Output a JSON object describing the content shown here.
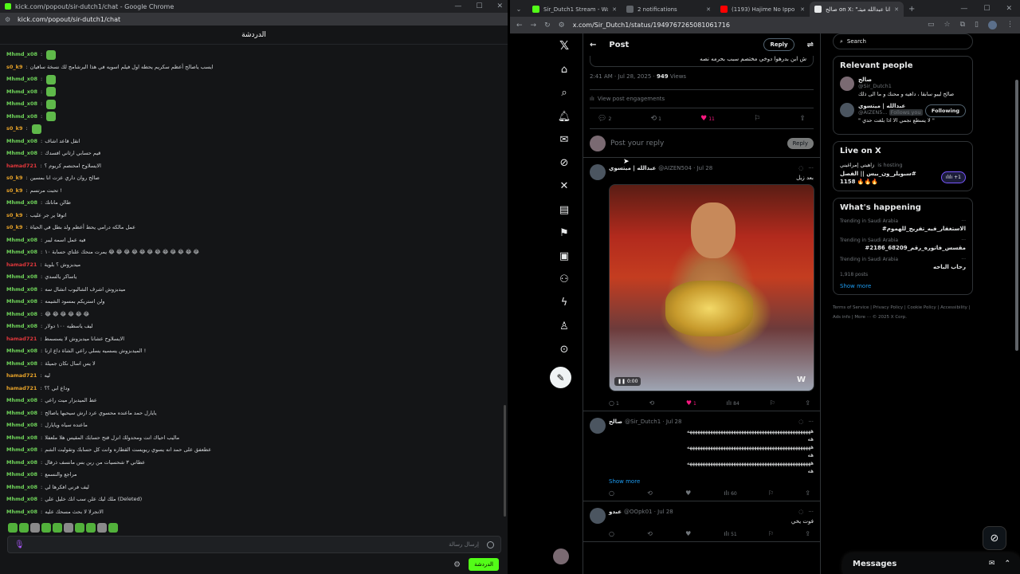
{
  "kick": {
    "window_title": "kick.com/popout/sir-dutch1/chat - Google Chrome",
    "url": "kick.com/popout/sir-dutch1/chat",
    "header": "الدردشة",
    "messages": [
      {
        "user": "Mhmd_x08",
        "text": "",
        "color": "#6fd35a",
        "emote": true
      },
      {
        "user": "s0_k9",
        "text": "ايسب ياصالح أعظم سكريم يحطه اول فيلم اسويه في هذا البرشامج لك نسخة سافيان",
        "color": "#e6a229",
        "emote": false
      },
      {
        "user": "Mhmd_x08",
        "text": "",
        "color": "#6fd35a",
        "emote": true
      },
      {
        "user": "Mhmd_x08",
        "text": "",
        "color": "#6fd35a",
        "emote": true
      },
      {
        "user": "Mhmd_x08",
        "text": "",
        "color": "#6fd35a",
        "emote": true
      },
      {
        "user": "Mhmd_x08",
        "text": "",
        "color": "#6fd35a",
        "emote": true
      },
      {
        "user": "s0_k9",
        "text": "",
        "color": "#e6a229",
        "emote": true
      },
      {
        "user": "Mhmd_x08",
        "text": "انقل قاعد اشاف",
        "color": "#6fd35a",
        "emote": false
      },
      {
        "user": "Mhmd_x08",
        "text": "قيم حسابي ارثاني افسدك",
        "color": "#6fd35a",
        "emote": false
      },
      {
        "user": "hamad721",
        "text": "الايسلاوح امحنصم كريوم ؟",
        "color": "#e0373b",
        "emote": false
      },
      {
        "user": "s0_k9",
        "text": "صالح روان داري عزت انا بمسين",
        "color": "#e6a229",
        "emote": false
      },
      {
        "user": "s0_k9",
        "text": "تحبت مرتسم !",
        "color": "#e6a229",
        "emote": false
      },
      {
        "user": "Mhmd_x08",
        "text": "طالن ماناتك",
        "color": "#6fd35a",
        "emote": false
      },
      {
        "user": "s0_k9",
        "text": "اتوقا ير جر عليب",
        "color": "#e6a229",
        "emote": false
      },
      {
        "user": "s0_k9",
        "text": "عمل مالكه درامي يحط أعظم ولد بطل في الحياة",
        "color": "#e6a229",
        "emote": false
      },
      {
        "user": "Mhmd_x08",
        "text": "فيه عمل اسمه ليبر",
        "color": "#6fd35a",
        "emote": false
      },
      {
        "user": "Mhmd_x08",
        "text": "يمرت منحك علناي حسابة ١٠ 😂 😂 😂 😂 😂 😂 😂 😂 😂 😂 😂 😂",
        "color": "#6fd35a",
        "emote": false
      },
      {
        "user": "hamad721",
        "text": "ميدبزوش ؟ بلوية",
        "color": "#e0373b",
        "emote": false
      },
      {
        "user": "Mhmd_x08",
        "text": "ياساكر يالسدي",
        "color": "#6fd35a",
        "emote": false
      },
      {
        "user": "Mhmd_x08",
        "text": "ميدبزوش اشرف الشاليوب انشال سه",
        "color": "#6fd35a",
        "emote": false
      },
      {
        "user": "Mhmd_x08",
        "text": "ولن استريكم بمسود الشيمه",
        "color": "#6fd35a",
        "emote": false
      },
      {
        "user": "Mhmd_x08",
        "text": "😂 😂 😂 😂 😂 😂",
        "color": "#6fd35a",
        "emote": false
      },
      {
        "user": "Mhmd_x08",
        "text": "ليف ياسطيه ١٠٠ دولار",
        "color": "#6fd35a",
        "emote": false
      },
      {
        "user": "hamad721",
        "text": "الايسلاوح عشانا ميدبزوش لا يسسمط",
        "color": "#e0373b",
        "emote": false
      },
      {
        "user": "Mhmd_x08",
        "text": "الميدبزوش يسسيه يسلي راعي الشاة داع ازنا !",
        "color": "#6fd35a",
        "emote": false
      },
      {
        "user": "Mhmd_x08",
        "text": "لا يس اسال نكان جميلة",
        "color": "#6fd35a",
        "emote": false
      },
      {
        "user": "hamad721",
        "text": "ليه",
        "color": "#e6a229",
        "emote": false
      },
      {
        "user": "hamad721",
        "text": "وداع ابي ؟؟",
        "color": "#e6a229",
        "emote": false
      },
      {
        "user": "Mhmd_x08",
        "text": "عط الميدبزار ميت راعي",
        "color": "#6fd35a",
        "emote": false
      },
      {
        "user": "Mhmd_x08",
        "text": "يايارل حمد ماعنده محسوي عرد ارش سيحيها ياصالح",
        "color": "#6fd35a",
        "emote": false
      },
      {
        "user": "Mhmd_x08",
        "text": "ماعنده سياه ويايارل",
        "color": "#6fd35a",
        "emote": false
      },
      {
        "user": "Mhmd_x08",
        "text": "ماليب احياك انت ومحدولك انزل قتح حسابك المقيس هلا ملعفلا",
        "color": "#6fd35a",
        "emote": false
      },
      {
        "user": "Mhmd_x08",
        "text": "عطعفق على حمد انه يسوي ريويست القطاره وانت كل حسابك وتقوليت الشم",
        "color": "#6fd35a",
        "emote": false
      },
      {
        "user": "Mhmd_x08",
        "text": "عطاني ٣ شحسيات من ربن بس مانسف ذرفال",
        "color": "#6fd35a",
        "emote": false
      },
      {
        "user": "Mhmd_x08",
        "text": "مراجع والنسمع",
        "color": "#6fd35a",
        "emote": false
      },
      {
        "user": "Mhmd_x08",
        "text": "ليف فرني افكرها لي",
        "color": "#6fd35a",
        "emote": false
      },
      {
        "user": "Mhmd_x08",
        "text": "ملك ليك علن سب انك خليل علي (Deleted)",
        "color": "#6fd35a",
        "emote": false
      },
      {
        "user": "Mhmd_x08",
        "text": "الانجرلا لا بحث مسحك عليه",
        "color": "#6fd35a",
        "emote": false
      }
    ],
    "input_placeholder": "إرسال رسالة",
    "send_label": "الدردشة"
  },
  "chrome": {
    "tabs": [
      {
        "title": "Sir_Dutch1 Stream - Watch",
        "color": "#53fc18",
        "active": false
      },
      {
        "title": "2 notifications",
        "color": "#5f6368",
        "active": false
      },
      {
        "title": "(1193) Hajime No Ippo OP 2",
        "color": "#ff0000",
        "active": false
      },
      {
        "title": "صالح on X: \"ليتك انا عبدالله ميتـ",
        "color": "#e7e9ea",
        "active": true
      }
    ],
    "url": "x.com/Sir_Dutch1/status/1949767265081061716"
  },
  "x": {
    "post_header": "Post",
    "reply_button": "Reply",
    "quoted_tail": "ش ابن بدرهوا دوخي مختصم سبب بحرمه نصه",
    "timestamp": "2:41 AM · Jul 28, 2025 · ",
    "views_count": "949",
    "views_label": " Views",
    "view_engagements": "View post engagements",
    "counts": {
      "replies": "2",
      "reposts": "1",
      "likes": "11"
    },
    "reply_placeholder": "Post your reply",
    "reply_btn": "Reply",
    "tweets": [
      {
        "name": "عبدالله | ميتسوي",
        "handle": "@AIZEN504 · Jul 28",
        "text": "بعد زيل",
        "replies": "1",
        "reposts": "",
        "likes": "1",
        "views": "84",
        "media": true,
        "media_time": "0:00",
        "media_logo": "W"
      },
      {
        "name": "صالح",
        "handle": "@Sir_Dutch1 · Jul 28",
        "text": "ههههههههههههههههههههههههههههههههههههههههههههههههه\nهه\nههههههههههههههههههههههههههههههههههههههههههههههههه\nهه\nههههههههههههههههههههههههههههههههههههههههههههههههه\nهه",
        "show_more": "Show more",
        "replies": "",
        "reposts": "",
        "likes": "",
        "views": "60",
        "media": false
      },
      {
        "name": "عبدو",
        "handle": "@OOpk01 · Jul 28",
        "text": "فوت يخي",
        "replies": "",
        "reposts": "",
        "likes": "",
        "views": "51",
        "media": false
      }
    ],
    "search_placeholder": "Search",
    "relevant_title": "Relevant people",
    "people": [
      {
        "name": "صالح",
        "handle": "@Sir_Dutch1",
        "bio": "صالح ليبو سابقا ، داهيه و محنك و ما الى ذلك",
        "follow": ""
      },
      {
        "name": "عبدالله | ميتسوي",
        "handle": "@AIZEN5...",
        "badge": "Follows you",
        "bio": "\" لا يسطع نجمي الا اذا بلغت حدي \"",
        "follow": "Following"
      }
    ],
    "live_title": "Live on X",
    "live": {
      "host": "زاهيتي إمراغيني",
      "hosting": "is hosting",
      "title": "سبويلر_ون_بيس || الفصل#\n1158 🔥🔥🔥",
      "count": "+1"
    },
    "happening_title": "What's happening",
    "trends": [
      {
        "loc": "Trending in Saudi Arabia",
        "tag": "#الاستغفار_فيه_تفريج_للهموم",
        "count": ""
      },
      {
        "loc": "Trending in Saudi Arabia",
        "tag": "#مقسس_فاتوره_رقم_68209_2186",
        "count": ""
      },
      {
        "loc": "Trending in Saudi Arabia",
        "tag": "رحاب الباحه",
        "count": "1,918 posts"
      }
    ],
    "show_more": "Show more",
    "footer": "Terms of Service  |  Privacy Policy  |  Cookie Policy  |  Accessibility  |  Ads info  |  More ···  © 2025 X Corp.",
    "messages_label": "Messages"
  },
  "icons": [
    "x-logo",
    "home-icon",
    "search-icon",
    "bell-icon",
    "mail-icon",
    "grok-icon",
    "x-icon",
    "list-icon",
    "bookmark-icon",
    "briefcase-icon",
    "people-icon",
    "bolt-icon",
    "profile-icon",
    "more-icon",
    "compose-icon"
  ]
}
